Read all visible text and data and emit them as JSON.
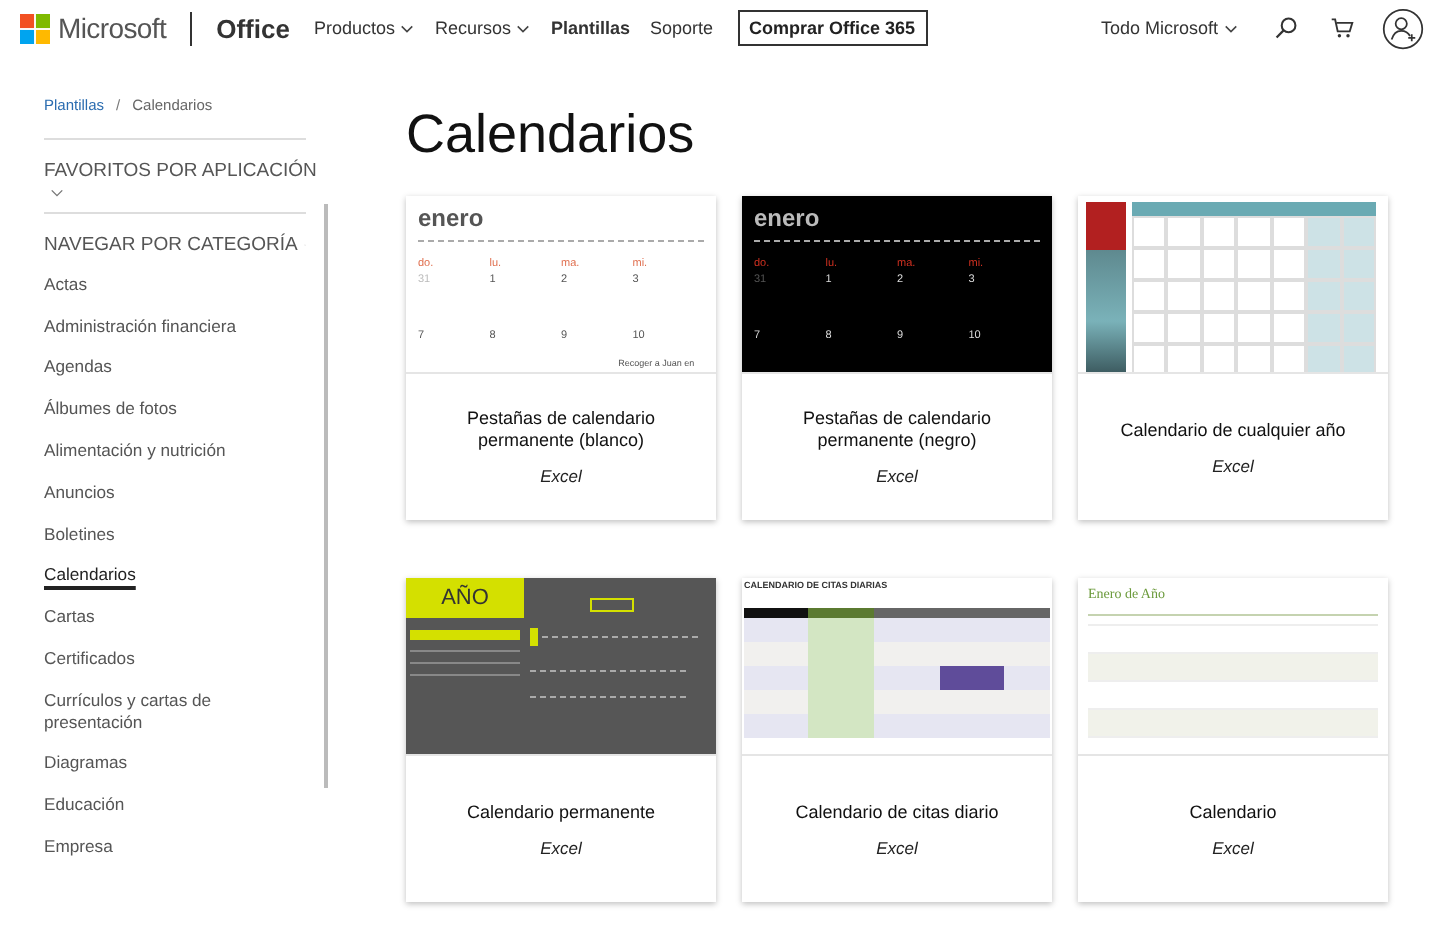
{
  "header": {
    "brand": "Microsoft",
    "product": "Office",
    "nav": [
      {
        "label": "Productos",
        "dropdown": true,
        "selected": false
      },
      {
        "label": "Recursos",
        "dropdown": true,
        "selected": false
      },
      {
        "label": "Plantillas",
        "dropdown": false,
        "selected": true
      },
      {
        "label": "Soporte",
        "dropdown": false,
        "selected": false
      }
    ],
    "buy_button": "Comprar Office 365",
    "all_microsoft": "Todo Microsoft"
  },
  "breadcrumb": {
    "separator": "/",
    "items": [
      {
        "label": "Plantillas",
        "link": true
      },
      {
        "label": "Calendarios",
        "link": false
      }
    ]
  },
  "sidebar": {
    "favorites": "FAVORITOS POR APLICACIÓN",
    "browse": "NAVEGAR POR CATEGORÍA",
    "items": [
      {
        "label": "Actas",
        "selected": false
      },
      {
        "label": "Administración financiera",
        "selected": false
      },
      {
        "label": "Agendas",
        "selected": false
      },
      {
        "label": "Álbumes de fotos",
        "selected": false
      },
      {
        "label": "Alimentación y nutrición",
        "selected": false
      },
      {
        "label": "Anuncios",
        "selected": false
      },
      {
        "label": "Boletines",
        "selected": false
      },
      {
        "label": "Calendarios",
        "selected": true
      },
      {
        "label": "Cartas",
        "selected": false
      },
      {
        "label": "Certificados",
        "selected": false
      },
      {
        "label": "Currículos y cartas de presentación",
        "selected": false
      },
      {
        "label": "Diagramas",
        "selected": false
      },
      {
        "label": "Educación",
        "selected": false
      },
      {
        "label": "Empresa",
        "selected": false
      }
    ]
  },
  "page_title": "Calendarios",
  "cards": [
    {
      "title": "Pestañas de calendario permanente (blanco)",
      "app": "Excel",
      "thumb": {
        "kind": "tabs-white",
        "month": "enero",
        "days": [
          "do.",
          "lu.",
          "ma.",
          "mi."
        ],
        "rows": [
          [
            "31",
            "1",
            "2",
            "3"
          ],
          [
            "7",
            "8",
            "9",
            "10"
          ]
        ],
        "note": "Recoger a Juan en"
      }
    },
    {
      "title": "Pestañas de calendario permanente (negro)",
      "app": "Excel",
      "thumb": {
        "kind": "tabs-black",
        "month": "enero",
        "days": [
          "do.",
          "lu.",
          "ma.",
          "mi."
        ],
        "rows": [
          [
            "31",
            "1",
            "2",
            "3"
          ],
          [
            "7",
            "8",
            "9",
            "10"
          ]
        ]
      }
    },
    {
      "title": "Calendario de cualquier año",
      "app": "Excel",
      "thumb": {
        "kind": "any-year"
      }
    },
    {
      "title": "Calendario permanente",
      "app": "Excel",
      "thumb": {
        "kind": "perpetual",
        "heading": "AÑO"
      }
    },
    {
      "title": "Calendario de citas diario",
      "app": "Excel",
      "thumb": {
        "kind": "appointments",
        "heading": "CALENDARIO DE CITAS DIARIAS"
      }
    },
    {
      "title": "Calendario",
      "app": "Excel",
      "thumb": {
        "kind": "monthly",
        "heading": "Enero de Año"
      }
    }
  ]
}
